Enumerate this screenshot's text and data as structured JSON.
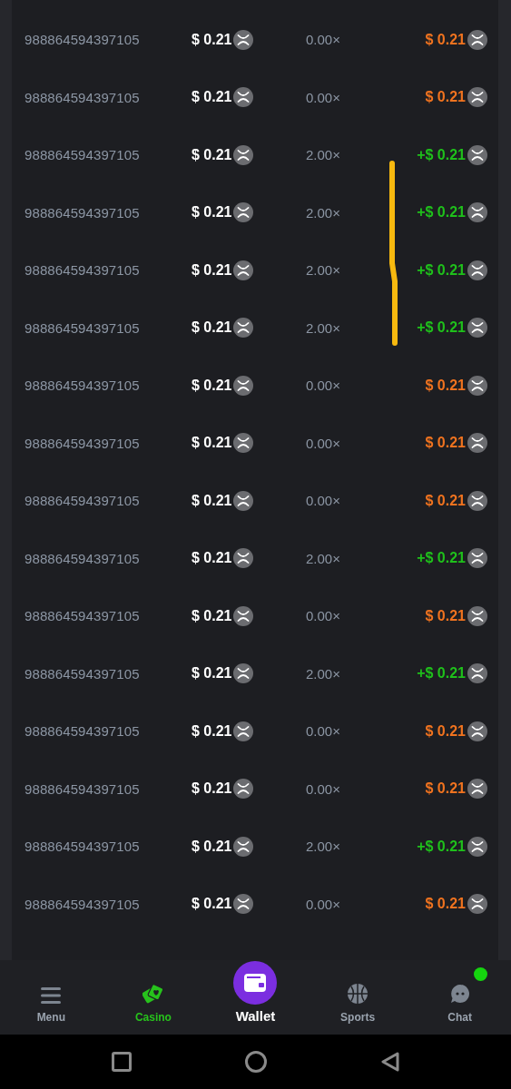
{
  "rows": [
    {
      "id": "988864594397105",
      "bet": "$ 0.21",
      "multiplier": "0.00×",
      "payout": "$ 0.21",
      "win": false
    },
    {
      "id": "988864594397105",
      "bet": "$ 0.21",
      "multiplier": "0.00×",
      "payout": "$ 0.21",
      "win": false
    },
    {
      "id": "988864594397105",
      "bet": "$ 0.21",
      "multiplier": "2.00×",
      "payout": "+$ 0.21",
      "win": true
    },
    {
      "id": "988864594397105",
      "bet": "$ 0.21",
      "multiplier": "2.00×",
      "payout": "+$ 0.21",
      "win": true
    },
    {
      "id": "988864594397105",
      "bet": "$ 0.21",
      "multiplier": "2.00×",
      "payout": "+$ 0.21",
      "win": true
    },
    {
      "id": "988864594397105",
      "bet": "$ 0.21",
      "multiplier": "2.00×",
      "payout": "+$ 0.21",
      "win": true
    },
    {
      "id": "988864594397105",
      "bet": "$ 0.21",
      "multiplier": "0.00×",
      "payout": "$ 0.21",
      "win": false
    },
    {
      "id": "988864594397105",
      "bet": "$ 0.21",
      "multiplier": "0.00×",
      "payout": "$ 0.21",
      "win": false
    },
    {
      "id": "988864594397105",
      "bet": "$ 0.21",
      "multiplier": "0.00×",
      "payout": "$ 0.21",
      "win": false
    },
    {
      "id": "988864594397105",
      "bet": "$ 0.21",
      "multiplier": "2.00×",
      "payout": "+$ 0.21",
      "win": true
    },
    {
      "id": "988864594397105",
      "bet": "$ 0.21",
      "multiplier": "0.00×",
      "payout": "$ 0.21",
      "win": false
    },
    {
      "id": "988864594397105",
      "bet": "$ 0.21",
      "multiplier": "2.00×",
      "payout": "+$ 0.21",
      "win": true
    },
    {
      "id": "988864594397105",
      "bet": "$ 0.21",
      "multiplier": "0.00×",
      "payout": "$ 0.21",
      "win": false
    },
    {
      "id": "988864594397105",
      "bet": "$ 0.21",
      "multiplier": "0.00×",
      "payout": "$ 0.21",
      "win": false
    },
    {
      "id": "988864594397105",
      "bet": "$ 0.21",
      "multiplier": "2.00×",
      "payout": "+$ 0.21",
      "win": true
    },
    {
      "id": "988864594397105",
      "bet": "$ 0.21",
      "multiplier": "0.00×",
      "payout": "$ 0.21",
      "win": false
    }
  ],
  "bottom_nav": [
    {
      "label": "Menu",
      "kind": "menu",
      "selected": false
    },
    {
      "label": "Casino",
      "kind": "casino",
      "selected": true
    },
    {
      "label": "Wallet",
      "kind": "wallet",
      "selected": false
    },
    {
      "label": "Sports",
      "kind": "sports",
      "selected": false
    },
    {
      "label": "Chat",
      "kind": "chat",
      "selected": false,
      "notification": true
    }
  ]
}
